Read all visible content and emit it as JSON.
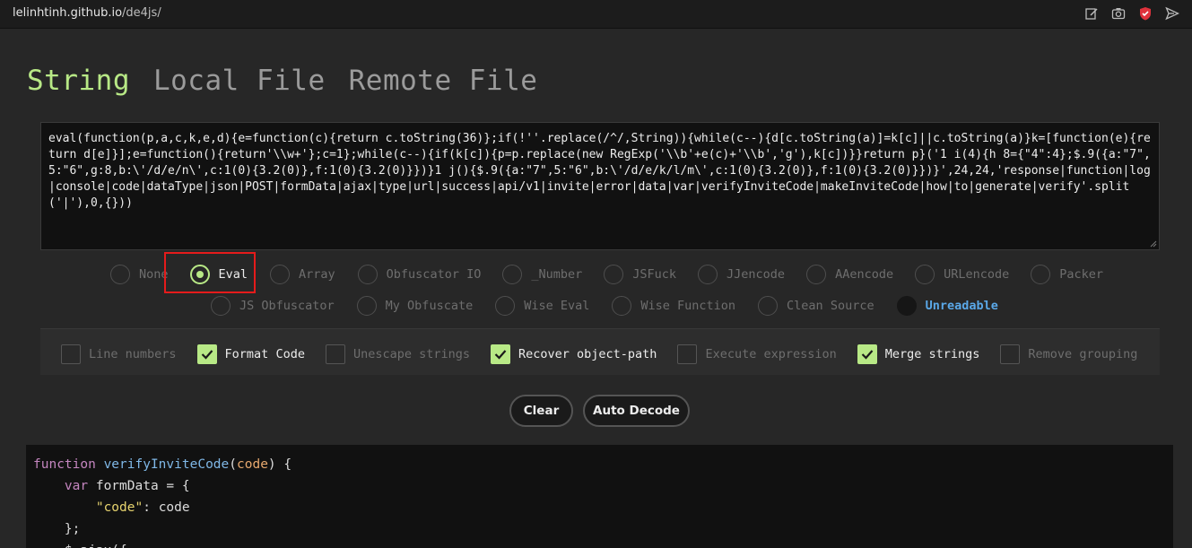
{
  "browser": {
    "url_host": "lelinhtinh.github.io",
    "url_path": "/de4js/",
    "icons": [
      "edit-icon",
      "camera-icon",
      "shield-extension-icon",
      "send-icon"
    ]
  },
  "tabs": [
    {
      "label": "String",
      "active": true
    },
    {
      "label": "Local File",
      "active": false
    },
    {
      "label": "Remote File",
      "active": false
    }
  ],
  "input": {
    "value": "eval(function(p,a,c,k,e,d){e=function(c){return c.toString(36)};if(!''.replace(/^/,String)){while(c--){d[c.toString(a)]=k[c]||c.toString(a)}k=[function(e){return d[e]}];e=function(){return'\\\\w+'};c=1};while(c--){if(k[c]){p=p.replace(new RegExp('\\\\b'+e(c)+'\\\\b','g'),k[c])}}return p}('1 i(4){h 8={\"4\":4};$.9({a:\"7\",5:\"6\",g:8,b:\\'/d/e/n\\',c:1(0){3.2(0)},f:1(0){3.2(0)}})}1 j(){$.9({a:\"7\",5:\"6\",b:\\'/d/e/k/l/m\\',c:1(0){3.2(0)},f:1(0){3.2(0)}})}',24,24,'response|function|log|console|code|dataType|json|POST|formData|ajax|type|url|success|api/v1|invite|error|data|var|verifyInviteCode|makeInviteCode|how|to|generate|verify'.split('|'),0,{}))"
  },
  "encodings_row1": [
    {
      "label": "None",
      "checked": false
    },
    {
      "label": "Eval",
      "checked": true
    },
    {
      "label": "Array",
      "checked": false
    },
    {
      "label": "Obfuscator IO",
      "checked": false
    },
    {
      "label": "_Number",
      "checked": false
    },
    {
      "label": "JSFuck",
      "checked": false
    },
    {
      "label": "JJencode",
      "checked": false
    },
    {
      "label": "AAencode",
      "checked": false
    },
    {
      "label": "URLencode",
      "checked": false
    },
    {
      "label": "Packer",
      "checked": false
    }
  ],
  "encodings_row2": [
    {
      "label": "JS Obfuscator",
      "checked": false
    },
    {
      "label": "My Obfuscate",
      "checked": false
    },
    {
      "label": "Wise Eval",
      "checked": false
    },
    {
      "label": "Wise Function",
      "checked": false
    },
    {
      "label": "Clean Source",
      "checked": false
    },
    {
      "label": "Unreadable",
      "checked": false
    }
  ],
  "options": [
    {
      "label": "Line numbers",
      "checked": false
    },
    {
      "label": "Format Code",
      "checked": true
    },
    {
      "label": "Unescape strings",
      "checked": false
    },
    {
      "label": "Recover object-path",
      "checked": true
    },
    {
      "label": "Execute expression",
      "checked": false
    },
    {
      "label": "Merge strings",
      "checked": true
    },
    {
      "label": "Remove grouping",
      "checked": false
    }
  ],
  "buttons": {
    "clear": "Clear",
    "auto_decode": "Auto Decode"
  },
  "output": {
    "lines": [
      [
        {
          "t": "kw",
          "v": "function "
        },
        {
          "t": "fn",
          "v": "verifyInviteCode"
        },
        {
          "t": "plain",
          "v": "("
        },
        {
          "t": "param",
          "v": "code"
        },
        {
          "t": "plain",
          "v": ") {"
        }
      ],
      [
        {
          "t": "plain",
          "v": "    "
        },
        {
          "t": "kw",
          "v": "var "
        },
        {
          "t": "plain",
          "v": "formData = {"
        }
      ],
      [
        {
          "t": "plain",
          "v": "        "
        },
        {
          "t": "str",
          "v": "\"code\""
        },
        {
          "t": "plain",
          "v": ": code"
        }
      ],
      [
        {
          "t": "plain",
          "v": "    };"
        }
      ],
      [
        {
          "t": "plain",
          "v": "    $.ajax({"
        }
      ]
    ]
  },
  "colors": {
    "accent": "#b8e986",
    "highlight": "#e51b1b",
    "unreadable": "#5aa8e8"
  }
}
